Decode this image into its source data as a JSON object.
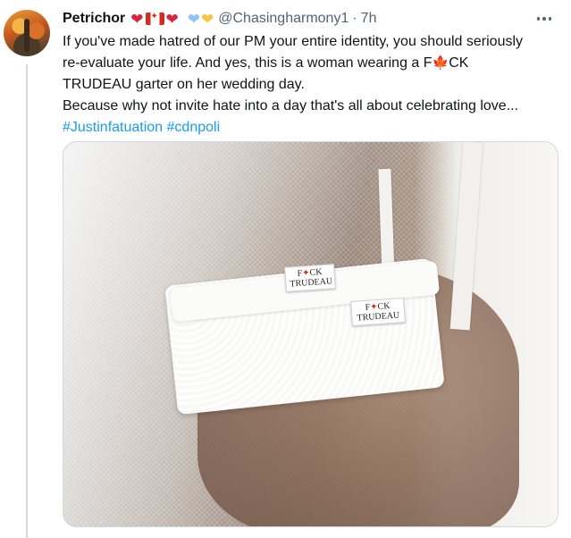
{
  "tweet": {
    "author": {
      "display_name": "Petrichor",
      "handle": "@Chasingharmony1",
      "avatar_icon": "autumn-trees-avatar"
    },
    "timestamp": "7h",
    "separator": "·",
    "emoji_badges": [
      "red-heart-icon",
      "canada-flag-icon",
      "red-heart-icon",
      "blue-heart-icon",
      "yellow-heart-icon"
    ],
    "text": {
      "line1": "If you've made hatred of our PM your entire identity, you should seriously",
      "line2_pre": "re-evaluate your life. And yes, this is a woman wearing a F",
      "line2_post": "CK",
      "line3": "TRUDEAU garter on her wedding day.",
      "line4": "Because why not invite hate into a day that's all about celebrating love...",
      "hashtags": [
        "#Justinfatuation",
        "#cdnpoli"
      ]
    },
    "media": {
      "tag_left": {
        "line1_pre": "F",
        "line1_post": "CK",
        "line2": "TRUDEAU"
      },
      "tag_right": {
        "line1_pre": "F",
        "line1_post": "CK",
        "line2": "TRUDEAU"
      }
    }
  },
  "colors": {
    "text": "#0f1419",
    "secondary": "#536471",
    "link": "#1d9bf0",
    "thread_line": "#cfd9de",
    "maple": "#d52b1e"
  }
}
